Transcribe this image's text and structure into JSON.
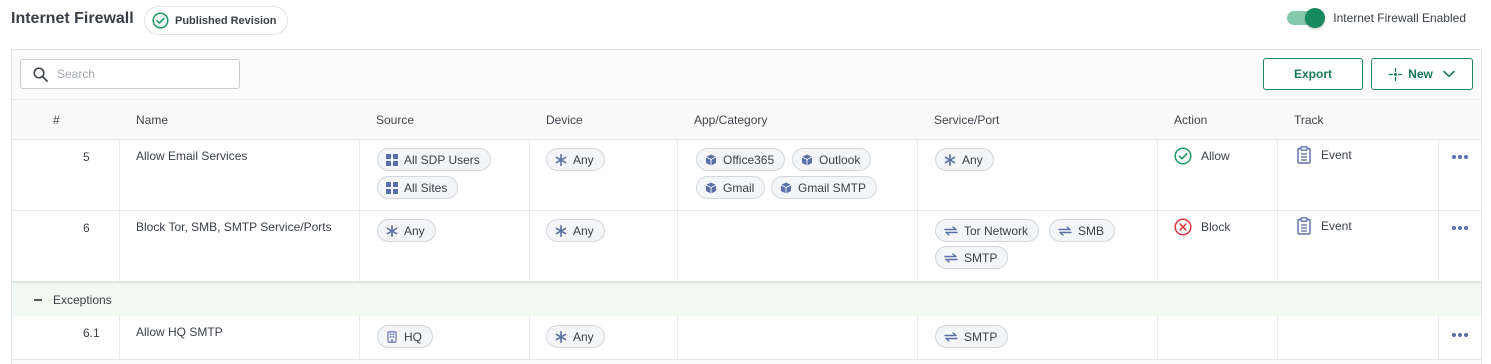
{
  "header": {
    "title": "Internet Firewall",
    "revision_badge": "Published Revision",
    "toggle_label": "Internet Firewall Enabled",
    "toggle_on": true
  },
  "toolbar": {
    "search_placeholder": "Search",
    "export_label": "Export",
    "new_label": "New"
  },
  "columns": [
    "#",
    "Name",
    "Source",
    "Device",
    "App/Category",
    "Service/Port",
    "Action",
    "Track"
  ],
  "rows": [
    {
      "num": "5",
      "name": "Allow Email Services",
      "source": [
        "All SDP Users",
        "All Sites"
      ],
      "device": [
        "Any"
      ],
      "app": [
        "Office365",
        "Outlook",
        "Gmail",
        "Gmail SMTP"
      ],
      "service": [
        "Any"
      ],
      "action": "Allow",
      "track": "Event"
    },
    {
      "num": "6",
      "name": "Block Tor, SMB, SMTP Service/Ports",
      "source": [
        "Any"
      ],
      "device": [
        "Any"
      ],
      "app": [],
      "service": [
        "Tor Network",
        "SMB",
        "SMTP"
      ],
      "action": "Block",
      "track": "Event"
    }
  ],
  "exceptions": {
    "label": "Exceptions",
    "rows": [
      {
        "num": "6.1",
        "name": "Allow HQ SMTP",
        "source": [
          "HQ"
        ],
        "device": [
          "Any"
        ],
        "service": [
          "SMTP"
        ]
      }
    ]
  },
  "colors": {
    "accent": "#168a5e",
    "allow": "#1f9a62",
    "block": "#d9363e",
    "icon_blue": "#5a6ea8"
  },
  "icons": {
    "revision": "check-circle-icon",
    "search": "search-icon",
    "new": "sparkle-icon",
    "chevron": "chevron-down-icon",
    "group": "grid-group-icon",
    "any": "asterisk-icon",
    "app": "cube-icon",
    "service": "arrows-exchange-icon",
    "site": "building-icon",
    "allow": "check-circle-icon",
    "block": "x-circle-icon",
    "track": "clipboard-icon",
    "more": "more-dots-icon"
  }
}
